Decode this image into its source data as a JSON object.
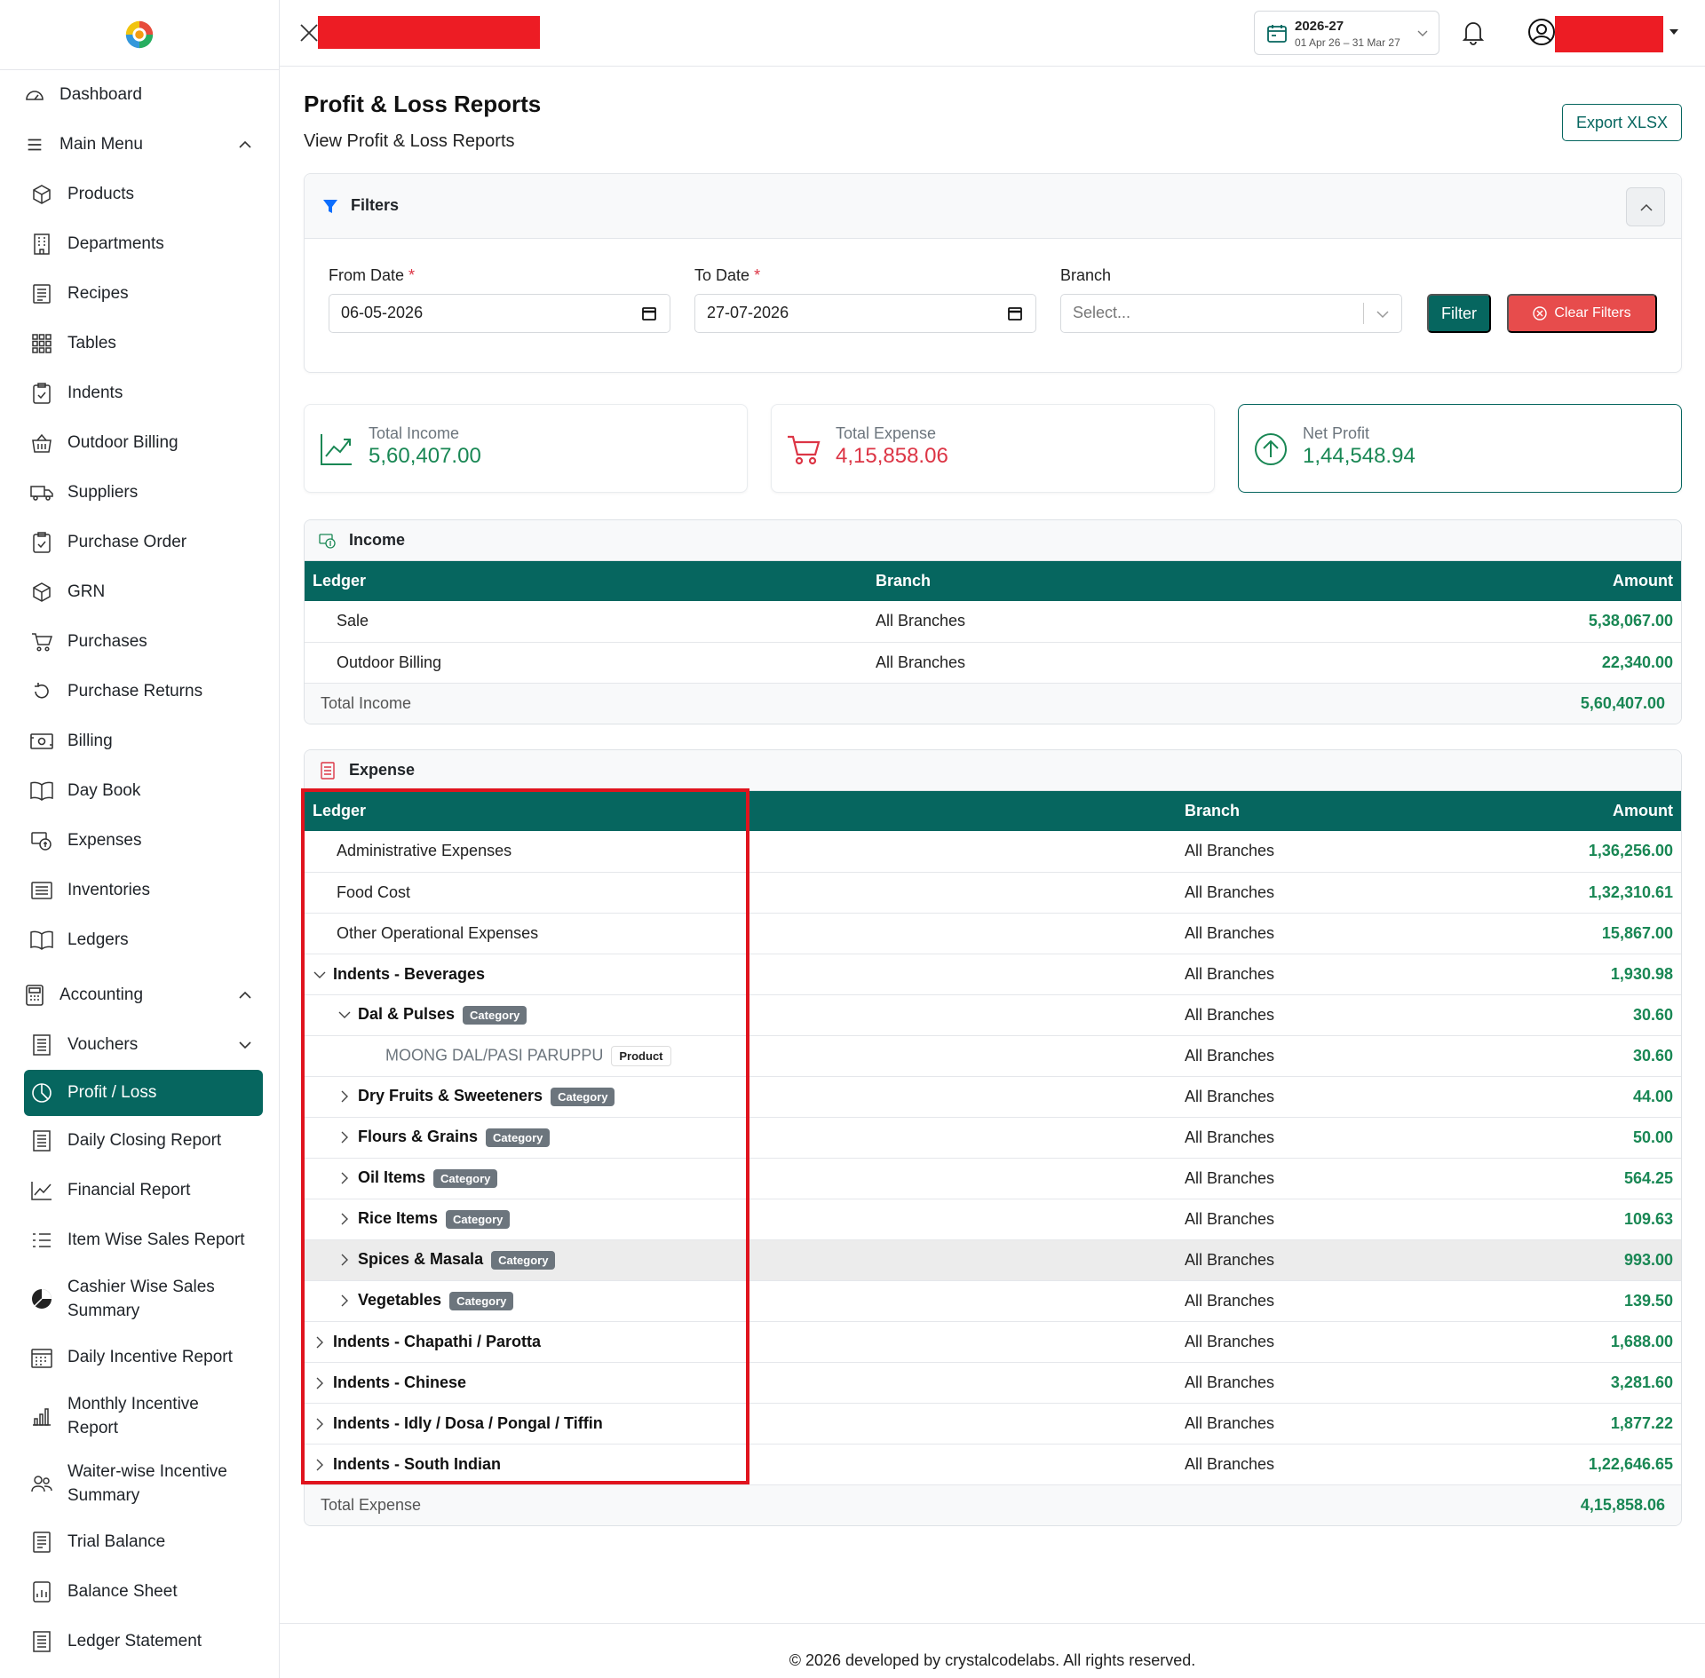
{
  "sidebar": {
    "items": [
      {
        "label": "Dashboard",
        "icon": "dashboard-icon"
      },
      {
        "label": "Main Menu",
        "icon": "menu-icon"
      },
      {
        "label": "Products",
        "icon": "box-icon"
      },
      {
        "label": "Departments",
        "icon": "building-icon"
      },
      {
        "label": "Recipes",
        "icon": "recipe-icon"
      },
      {
        "label": "Tables",
        "icon": "grid-icon"
      },
      {
        "label": "Indents",
        "icon": "clipboard-icon"
      },
      {
        "label": "Outdoor Billing",
        "icon": "basket-icon"
      },
      {
        "label": "Suppliers",
        "icon": "truck-icon"
      },
      {
        "label": "Purchase Order",
        "icon": "clipboard-check-icon"
      },
      {
        "label": "GRN",
        "icon": "box-icon"
      },
      {
        "label": "Purchases",
        "icon": "cart-icon"
      },
      {
        "label": "Purchase Returns",
        "icon": "return-icon"
      },
      {
        "label": "Billing",
        "icon": "cash-icon"
      },
      {
        "label": "Day Book",
        "icon": "book-icon"
      },
      {
        "label": "Expenses",
        "icon": "expense-icon"
      },
      {
        "label": "Inventories",
        "icon": "list-icon"
      },
      {
        "label": "Ledgers",
        "icon": "book-icon"
      },
      {
        "label": "Accounting",
        "icon": "calculator-icon"
      },
      {
        "label": "Vouchers",
        "icon": "receipt-icon"
      },
      {
        "label": "Profit / Loss",
        "icon": "pie-icon"
      },
      {
        "label": "Daily Closing Report",
        "icon": "receipt-icon"
      },
      {
        "label": "Financial Report",
        "icon": "chart-line-icon"
      },
      {
        "label": "Item Wise Sales Report",
        "icon": "list-ol-icon"
      },
      {
        "label": "Cashier Wise Sales",
        "label2": "Summary",
        "icon": "pie-filled-icon"
      },
      {
        "label": "Daily Incentive Report",
        "icon": "calendar-icon"
      },
      {
        "label": "Monthly Incentive",
        "label2": "Report",
        "icon": "bar-chart-icon"
      },
      {
        "label": "Waiter-wise Incentive",
        "label2": "Summary",
        "icon": "people-icon"
      },
      {
        "label": "Trial Balance",
        "icon": "journal-icon"
      },
      {
        "label": "Balance Sheet",
        "icon": "calc-sheet-icon"
      },
      {
        "label": "Ledger Statement",
        "icon": "receipt-icon"
      }
    ]
  },
  "header": {
    "fy_year": "2026-27",
    "fy_range": "01 Apr 26 – 31 Mar 27"
  },
  "page": {
    "title": "Profit & Loss Reports",
    "subtitle": "View Profit & Loss Reports",
    "export_label": "Export XLSX"
  },
  "filters": {
    "title": "Filters",
    "from_label": "From Date",
    "from_value": "06-05-2026",
    "to_label": "To Date",
    "to_value": "27-07-2026",
    "branch_label": "Branch",
    "branch_placeholder": "Select...",
    "filter_btn": "Filter",
    "clear_btn": "Clear Filters",
    "required_mark": "*"
  },
  "stats": {
    "income": {
      "label": "Total Income",
      "value": "5,60,407.00",
      "color": "#198754"
    },
    "expense": {
      "label": "Total Expense",
      "value": "4,15,858.06",
      "color": "#dc3545"
    },
    "net": {
      "label": "Net Profit",
      "value": "1,44,548.94",
      "color": "#198754"
    }
  },
  "income": {
    "title": "Income",
    "columns": [
      "Ledger",
      "Branch",
      "Amount"
    ],
    "rows": [
      {
        "ledger": "Sale",
        "branch": "All Branches",
        "amount": "5,38,067.00"
      },
      {
        "ledger": "Outdoor Billing",
        "branch": "All Branches",
        "amount": "22,340.00"
      }
    ],
    "total_label": "Total Income",
    "total": "5,60,407.00"
  },
  "expense": {
    "title": "Expense",
    "columns": [
      "Ledger",
      "Branch",
      "Amount"
    ],
    "rows": [
      {
        "ledger": "Administrative Expenses",
        "branch": "All Branches",
        "amount": "1,36,256.00"
      },
      {
        "ledger": "Food Cost",
        "branch": "All Branches",
        "amount": "1,32,310.61"
      },
      {
        "ledger": "Other Operational Expenses",
        "branch": "All Branches",
        "amount": "15,867.00"
      },
      {
        "ledger": "Indents - Beverages",
        "branch": "All Branches",
        "amount": "1,930.98"
      },
      {
        "ledger": "Dal & Pulses",
        "badge": "Category",
        "branch": "All Branches",
        "amount": "30.60"
      },
      {
        "ledger": "MOONG DAL/PASI PARUPPU",
        "badge": "Product",
        "branch": "All Branches",
        "amount": "30.60"
      },
      {
        "ledger": "Dry Fruits & Sweeteners",
        "badge": "Category",
        "branch": "All Branches",
        "amount": "44.00"
      },
      {
        "ledger": "Flours & Grains",
        "badge": "Category",
        "branch": "All Branches",
        "amount": "50.00"
      },
      {
        "ledger": "Oil Items",
        "badge": "Category",
        "branch": "All Branches",
        "amount": "564.25"
      },
      {
        "ledger": "Rice Items",
        "badge": "Category",
        "branch": "All Branches",
        "amount": "109.63"
      },
      {
        "ledger": "Spices & Masala",
        "badge": "Category",
        "branch": "All Branches",
        "amount": "993.00"
      },
      {
        "ledger": "Vegetables",
        "badge": "Category",
        "branch": "All Branches",
        "amount": "139.50"
      },
      {
        "ledger": "Indents - Chapathi / Parotta",
        "branch": "All Branches",
        "amount": "1,688.00"
      },
      {
        "ledger": "Indents - Chinese",
        "branch": "All Branches",
        "amount": "3,281.60"
      },
      {
        "ledger": "Indents - Idly / Dosa / Pongal / Tiffin",
        "branch": "All Branches",
        "amount": "1,877.22"
      },
      {
        "ledger": "Indents - South Indian",
        "branch": "All Branches",
        "amount": "1,22,646.65"
      }
    ],
    "total_label": "Total Expense",
    "total": "4,15,858.06"
  },
  "footer": {
    "text": "© 2026 developed by crystalcodelabs. All rights reserved."
  },
  "colors": {
    "brand": "#06665f",
    "danger": "#e74c4c",
    "success": "#198754"
  }
}
